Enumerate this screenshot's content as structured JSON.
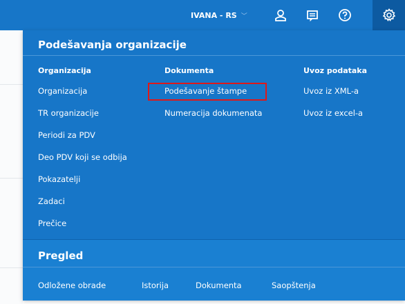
{
  "header": {
    "user_label": "IVANA - RS",
    "icons": [
      "user-icon",
      "messages-icon",
      "help-icon",
      "settings-icon"
    ]
  },
  "menu": {
    "title": "Podešavanja organizacije",
    "columns": [
      {
        "heading": "Organizacija",
        "items": [
          "Organizacija",
          "TR organizacije",
          "Periodi za PDV",
          "Deo PDV koji se odbija",
          "Pokazatelji",
          "Zadaci",
          "Prečice"
        ]
      },
      {
        "heading": "Dokumenta",
        "items": [
          "Podešavanje štampe",
          "Numeracija dokumenata"
        ]
      },
      {
        "heading": "Uvoz podataka",
        "items": [
          "Uvoz iz XML-a",
          "Uvoz iz excel-a"
        ]
      }
    ],
    "highlighted_item": "Podešavanje štampe",
    "highlight_color": "#e01818"
  },
  "pregled": {
    "title": "Pregled",
    "items": [
      "Odložene obrade",
      "Istorija",
      "Dokumenta",
      "Saopštenja"
    ]
  },
  "colors": {
    "primary": "#1776c8",
    "active_tab": "#0d5aa1",
    "text": "#ffffff"
  }
}
